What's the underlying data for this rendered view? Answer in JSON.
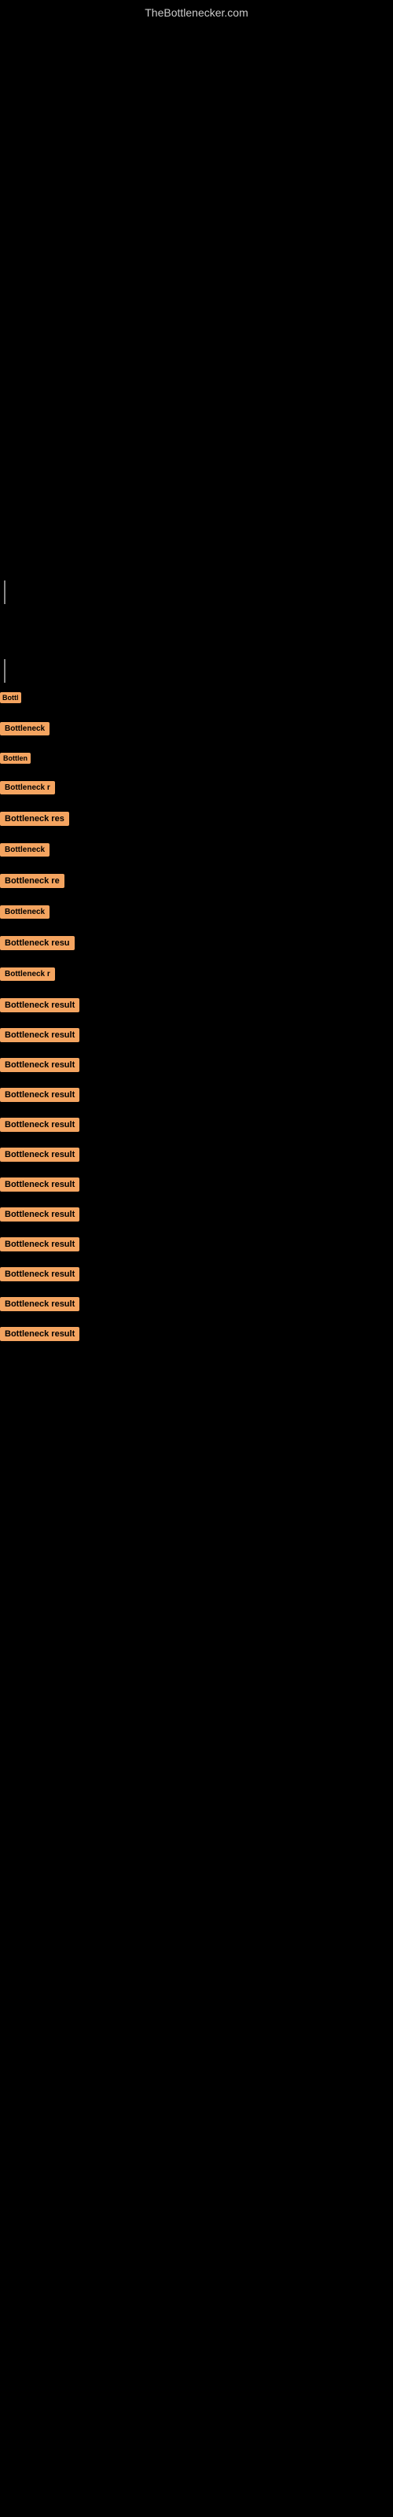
{
  "site": {
    "title": "TheBottlenecker.com"
  },
  "results": [
    {
      "label": "Bottl",
      "size": "tiny"
    },
    {
      "label": "Bottleneck",
      "size": "small"
    },
    {
      "label": "Bottlen",
      "size": "tiny"
    },
    {
      "label": "Bottleneck r",
      "size": "small"
    },
    {
      "label": "Bottleneck res",
      "size": "medium"
    },
    {
      "label": "Bottleneck",
      "size": "small"
    },
    {
      "label": "Bottleneck re",
      "size": "medium"
    },
    {
      "label": "Bottleneck",
      "size": "small"
    },
    {
      "label": "Bottleneck resu",
      "size": "medium"
    },
    {
      "label": "Bottleneck r",
      "size": "small"
    },
    {
      "label": "Bottleneck result",
      "size": "full"
    },
    {
      "label": "Bottleneck result",
      "size": "full"
    },
    {
      "label": "Bottleneck result",
      "size": "full"
    },
    {
      "label": "Bottleneck result",
      "size": "full"
    },
    {
      "label": "Bottleneck result",
      "size": "full"
    },
    {
      "label": "Bottleneck result",
      "size": "full"
    },
    {
      "label": "Bottleneck result",
      "size": "full"
    },
    {
      "label": "Bottleneck result",
      "size": "full"
    },
    {
      "label": "Bottleneck result",
      "size": "full"
    },
    {
      "label": "Bottleneck result",
      "size": "full"
    },
    {
      "label": "Bottleneck result",
      "size": "full"
    },
    {
      "label": "Bottleneck result",
      "size": "full"
    }
  ]
}
